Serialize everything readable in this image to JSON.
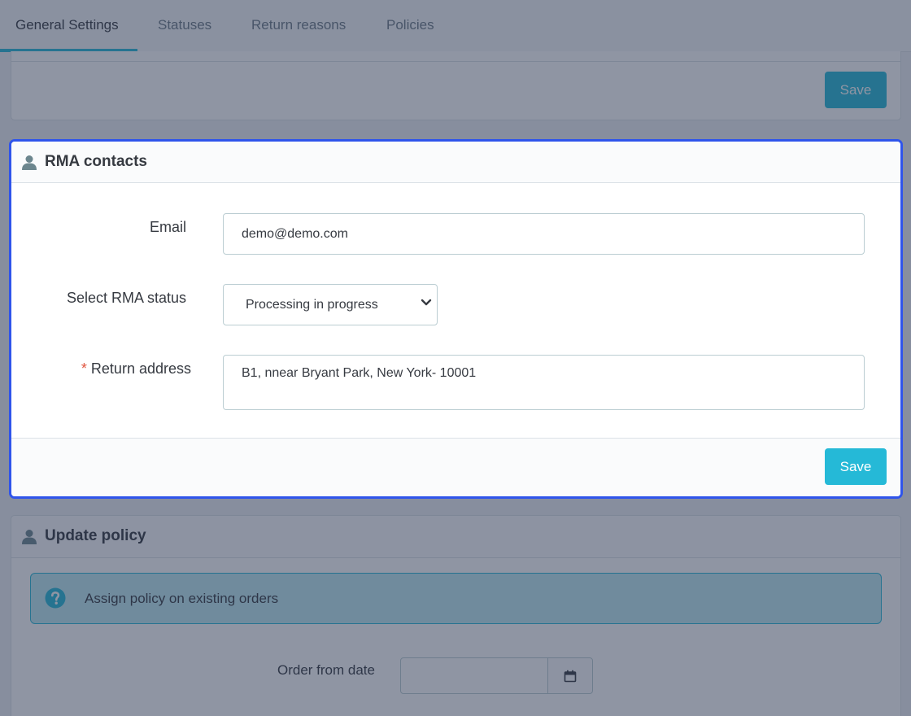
{
  "tabs": [
    {
      "label": "General Settings",
      "active": true
    },
    {
      "label": "Statuses",
      "active": false
    },
    {
      "label": "Return reasons",
      "active": false
    },
    {
      "label": "Policies",
      "active": false
    }
  ],
  "top_panel": {
    "save_label": "Save"
  },
  "rma_contacts": {
    "title": "RMA contacts",
    "icon": "user-icon",
    "email": {
      "label": "Email",
      "value": "demo@demo.com"
    },
    "status": {
      "label": "Select RMA status",
      "selected": "Processing in progress"
    },
    "return_address": {
      "required_mark": "*",
      "label": "Return address",
      "value": "B1, nnear Bryant Park, New York- 10001"
    },
    "save_label": "Save"
  },
  "update_policy": {
    "title": "Update policy",
    "icon": "user-icon",
    "alert": {
      "icon": "question-circle-icon",
      "text": "Assign policy on existing orders"
    },
    "order_from_date": {
      "label": "Order from date",
      "value": "",
      "addon_icon": "calendar-icon"
    }
  },
  "colors": {
    "accent": "#25b9d7",
    "focus_border": "#2f54eb",
    "required": "#e0553f",
    "text": "#363a41",
    "muted_text": "#6c7a86"
  }
}
